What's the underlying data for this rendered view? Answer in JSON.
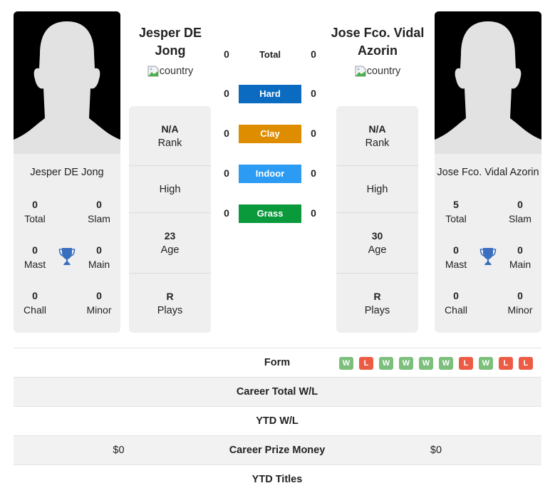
{
  "player1": {
    "name": "Jesper DE Jong",
    "header_name_line1": "Jesper DE",
    "header_name_line2": "Jong",
    "flag_alt": "country",
    "titles": {
      "total": {
        "value": "0",
        "label": "Total"
      },
      "slam": {
        "value": "0",
        "label": "Slam"
      },
      "mast": {
        "value": "0",
        "label": "Mast"
      },
      "main": {
        "value": "0",
        "label": "Main"
      },
      "chall": {
        "value": "0",
        "label": "Chall"
      },
      "minor": {
        "value": "0",
        "label": "Minor"
      }
    },
    "stats": {
      "rank": {
        "value": "N/A",
        "label": "Rank"
      },
      "high": {
        "label": "High"
      },
      "age": {
        "value": "23",
        "label": "Age"
      },
      "plays": {
        "value": "R",
        "label": "Plays"
      }
    }
  },
  "player2": {
    "name": "Jose Fco. Vidal Azorin",
    "header_name_line1": "Jose Fco. Vidal",
    "header_name_line2": "Azorin",
    "flag_alt": "country",
    "titles": {
      "total": {
        "value": "5",
        "label": "Total"
      },
      "slam": {
        "value": "0",
        "label": "Slam"
      },
      "mast": {
        "value": "0",
        "label": "Mast"
      },
      "main": {
        "value": "0",
        "label": "Main"
      },
      "chall": {
        "value": "0",
        "label": "Chall"
      },
      "minor": {
        "value": "0",
        "label": "Minor"
      }
    },
    "stats": {
      "rank": {
        "value": "N/A",
        "label": "Rank"
      },
      "high": {
        "label": "High"
      },
      "age": {
        "value": "30",
        "label": "Age"
      },
      "plays": {
        "value": "R",
        "label": "Plays"
      }
    }
  },
  "h2h": [
    {
      "label": "Total",
      "p1": "0",
      "p2": "0",
      "color": ""
    },
    {
      "label": "Hard",
      "p1": "0",
      "p2": "0",
      "color": "#0a6bc1"
    },
    {
      "label": "Clay",
      "p1": "0",
      "p2": "0",
      "color": "#de8d00"
    },
    {
      "label": "Indoor",
      "p1": "0",
      "p2": "0",
      "color": "#2b9bf4"
    },
    {
      "label": "Grass",
      "p1": "0",
      "p2": "0",
      "color": "#0a9a3c"
    }
  ],
  "comparison": {
    "form": {
      "label": "Form",
      "results": [
        "W",
        "L",
        "W",
        "W",
        "W",
        "W",
        "L",
        "W",
        "L",
        "L"
      ]
    },
    "career_total_wl": {
      "label": "Career Total W/L",
      "p1": "",
      "p2": ""
    },
    "ytd_wl": {
      "label": "YTD W/L",
      "p1": "",
      "p2": ""
    },
    "career_prize_money": {
      "label": "Career Prize Money",
      "p1": "$0",
      "p2": "$0"
    },
    "ytd_titles": {
      "label": "YTD Titles",
      "p1": "",
      "p2": ""
    }
  },
  "colors": {
    "win": "#7cbf7c",
    "loss": "#ec5c45",
    "trophy": "#3a6fbf"
  }
}
